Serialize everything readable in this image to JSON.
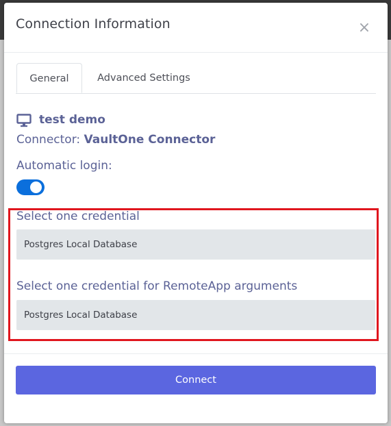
{
  "modal": {
    "title": "Connection Information",
    "close_glyph": "×"
  },
  "tabs": [
    {
      "label": "General",
      "active": true
    },
    {
      "label": "Advanced Settings",
      "active": false
    }
  ],
  "connection": {
    "icon": "monitor-icon",
    "name": "test demo",
    "connector_prefix": "Connector:",
    "connector_name": "VaultOne Connector"
  },
  "automatic_login": {
    "label": "Automatic login:",
    "enabled": true
  },
  "credential": {
    "label": "Select one credential",
    "selected": "Postgres Local Database"
  },
  "remoteapp_credential": {
    "label": "Select one credential for RemoteApp arguments",
    "selected": "Postgres Local Database"
  },
  "footer": {
    "connect_label": "Connect"
  },
  "colors": {
    "accent": "#5b66e0",
    "toggle_on": "#0b6fdc",
    "highlight": "#e0161e",
    "label_text": "#5b6296"
  }
}
